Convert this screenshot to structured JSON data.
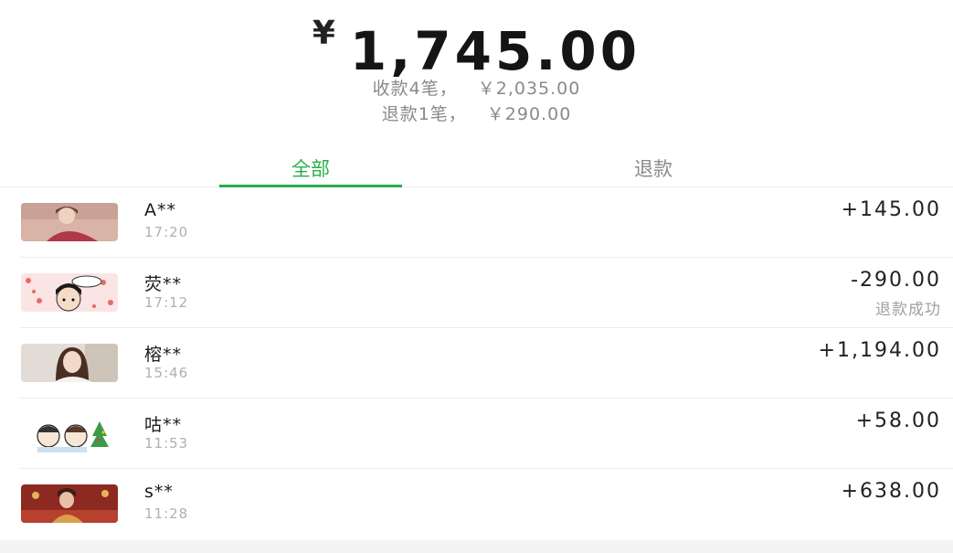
{
  "summary": {
    "currency": "¥",
    "total": "1,745.00",
    "income_label": "收款4笔，",
    "income_amount": "￥2,035.00",
    "refund_label": "退款1笔，",
    "refund_amount": "￥290.00"
  },
  "tabs": [
    {
      "label": "全部",
      "active": true
    },
    {
      "label": "退款",
      "active": false
    }
  ],
  "colors": {
    "accent": "#2aad4a",
    "muted": "#8a8a8a",
    "divider": "#ececec"
  },
  "transactions": [
    {
      "name": "A**",
      "time": "17:20",
      "amount": "+145.00",
      "status": ""
    },
    {
      "name": "荧**",
      "time": "17:12",
      "amount": "-290.00",
      "status": "退款成功"
    },
    {
      "name": "榕**",
      "time": "15:46",
      "amount": "+1,194.00",
      "status": ""
    },
    {
      "name": "咕**",
      "time": "11:53",
      "amount": "+58.00",
      "status": ""
    },
    {
      "name": "s**",
      "time": "11:28",
      "amount": "+638.00",
      "status": ""
    }
  ]
}
